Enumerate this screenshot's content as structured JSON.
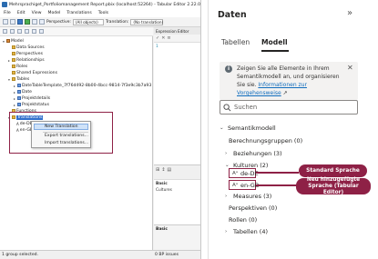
{
  "tabular_editor": {
    "title": "Mehrsprachiget_Portfoliomanagement Report.pbix (localhost:52264) - Tabular Editor 2.22.0",
    "menu": [
      "File",
      "Edit",
      "View",
      "Model",
      "Translations",
      "Tools"
    ],
    "perspective_label": "Perspective:",
    "perspective_value": "(All objects)",
    "translation_label": "Translation:",
    "translation_value": "(No translation)",
    "expression_editor_title": "Expression Editor",
    "expression_line": "1",
    "tree": {
      "model": "Model",
      "data_sources": "Data Sources",
      "perspectives": "Perspectives",
      "relationships": "Relationships",
      "roles": "Roles",
      "shared_expressions": "Shared Expressions",
      "tables": "Tables",
      "date_template": "DateTableTemplate_7f76d492-8b00-4bcc-9814-7f3e9c3b7a93",
      "date": "Date",
      "projektdetails": "Projektdetails",
      "projektstatus": "Projektstatus",
      "functions": "Functions",
      "translations": "Translations",
      "lang1": "de-DE",
      "lang2": "en-GB"
    },
    "context_menu": [
      "New Translation",
      "Export translations...",
      "Import translations..."
    ],
    "properties": {
      "basic_row": "Basic",
      "cultures_row": "Cultures"
    },
    "status_left": "1 group selected.",
    "status_right": "0 BP issues"
  },
  "powerbi": {
    "title": "Daten",
    "collapse_icon": "»",
    "tabs": [
      "Tabellen",
      "Modell"
    ],
    "active_tab": "Modell",
    "info_text": "Zeigen Sie alle Elemente in Ihrem Semantikmodell an, und organisieren Sie sie.",
    "info_link": "Informationen zur Vorgehensweise",
    "info_link_suffix": "↗",
    "search_placeholder": "Suchen",
    "tree": {
      "root": "Semantikmodell",
      "calc_groups": "Berechnungsgruppen (0)",
      "relationships": "Beziehungen (3)",
      "cultures": "Kulturen (2)",
      "culture1": "de-DE",
      "culture2": "en-GB",
      "measures": "Measures (3)",
      "perspectives": "Perspektiven (0)",
      "roles": "Rollen (0)",
      "tables": "Tabellen (4)"
    },
    "callouts": {
      "standard": "Standard Sprache",
      "new_line1": "Neu hinzugefügte",
      "new_line2": "Sprache (Tabular Editor)"
    },
    "accent_color": "#8e2146"
  }
}
